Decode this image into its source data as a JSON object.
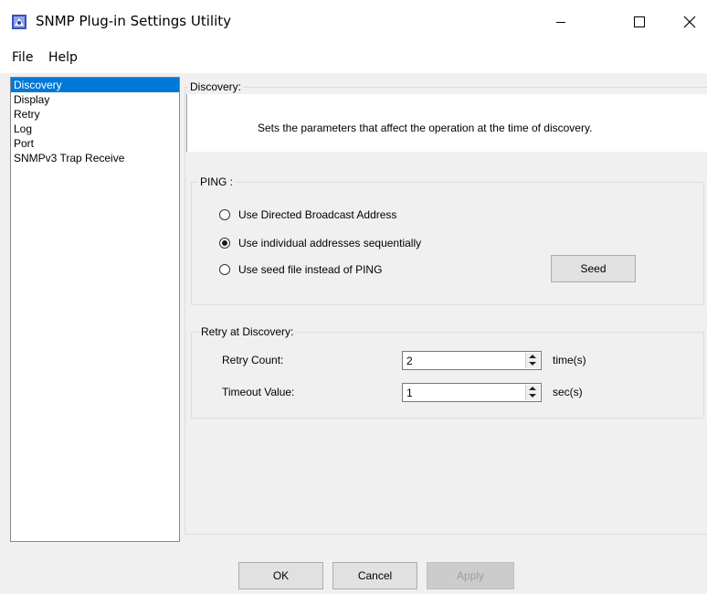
{
  "window": {
    "title": "SNMP Plug-in Settings Utility",
    "controls": [
      "minimize",
      "maximize",
      "close"
    ]
  },
  "menu": {
    "items": [
      "File",
      "Help"
    ]
  },
  "sidebar": {
    "items": [
      {
        "label": "Discovery",
        "selected": true
      },
      {
        "label": "Display",
        "selected": false
      },
      {
        "label": "Retry",
        "selected": false
      },
      {
        "label": "Log",
        "selected": false
      },
      {
        "label": "Port",
        "selected": false
      },
      {
        "label": "SNMPv3 Trap Receive",
        "selected": false
      }
    ]
  },
  "discovery": {
    "group_label": "Discovery:",
    "description": "Sets the parameters that affect the operation at the time of discovery."
  },
  "ping": {
    "group_label": "PING :",
    "options": [
      {
        "label": "Use Directed Broadcast Address",
        "selected": false
      },
      {
        "label": "Use individual addresses sequentially",
        "selected": true
      },
      {
        "label": "Use seed file instead of PING",
        "selected": false
      }
    ],
    "seed_button": "Seed"
  },
  "retry": {
    "group_label": "Retry at Discovery:",
    "retry_count_label": "Retry Count:",
    "retry_count_value": "2",
    "retry_count_unit": "time(s)",
    "timeout_label": "Timeout Value:",
    "timeout_value": "1",
    "timeout_unit": "sec(s)"
  },
  "buttons": {
    "ok": "OK",
    "cancel": "Cancel",
    "apply": "Apply"
  },
  "colors": {
    "selection": "#0078d7",
    "background": "#f0f0f0"
  }
}
